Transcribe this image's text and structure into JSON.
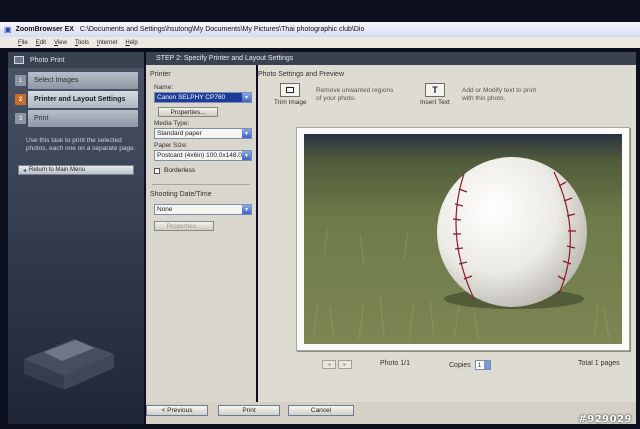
{
  "window": {
    "app": "ZoomBrowser EX",
    "path": "C:\\Documents and Settings\\hsutong\\My Documents\\My Pictures\\Thai photographic club\\Dio"
  },
  "menu": [
    "File",
    "Edit",
    "View",
    "Tools",
    "Internet",
    "Help"
  ],
  "left_panel": {
    "title": "Photo Print",
    "steps": [
      {
        "num": "1",
        "label": "Select Images"
      },
      {
        "num": "2",
        "label": "Printer and Layout Settings"
      },
      {
        "num": "3",
        "label": "Print"
      }
    ],
    "description": "Use this task to print the selected photos, each one on a separate page.",
    "return_label": "Return to Main Menu"
  },
  "step_header": "STEP 2: Specify Printer and Layout Settings",
  "printer": {
    "section": "Printer",
    "name_label": "Name:",
    "name_value": "Canon SELPHY CP760",
    "properties_label": "Properties...",
    "media_type_label": "Media Type:",
    "media_type_value": "Standard paper",
    "paper_size_label": "Paper Size:",
    "paper_size_value": "Postcard (4x6in) 100.0x148.0",
    "borderless_label": "Borderless"
  },
  "shooting_date": {
    "section": "Shooting Date/Time",
    "value": "None",
    "properties_label": "Properties..."
  },
  "preview": {
    "header": "Photo Settings and Preview",
    "trim_label": "Trim Image",
    "trim_desc": "Remove unwanted regions of your photo.",
    "text_label": "Insert Text",
    "text_desc": "Add or Modify text to print with this photo.",
    "photo_counter": "Photo 1/1",
    "copies_label": "Copies",
    "copies_value": "1",
    "total_pages": "Total 1 pages"
  },
  "buttons": {
    "previous": "< Previous",
    "print": "Print",
    "cancel": "Cancel"
  },
  "watermark": "#929029"
}
